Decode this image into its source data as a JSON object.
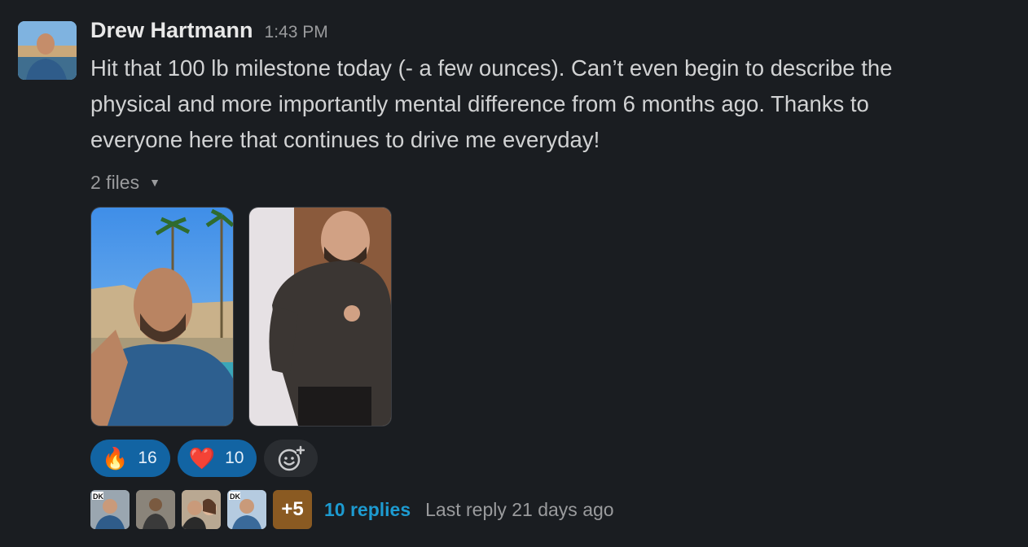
{
  "message": {
    "author": "Drew Hartmann",
    "time": "1:43 PM",
    "lines": [
      "Hit that 100 lb milestone today (- a few ounces).  Can’t even begin to describe the",
      "physical and more importantly mental difference from 6 months ago.  Thanks to",
      "everyone here that continues to drive me everyday!"
    ]
  },
  "files": {
    "label": "2 files",
    "caret_icon": "caret-down-icon"
  },
  "reactions": [
    {
      "emoji": "🔥",
      "count": "16",
      "icon": "fire-emoji"
    },
    {
      "emoji": "❤️",
      "count": "10",
      "icon": "heart-emoji"
    }
  ],
  "thread": {
    "more_count": "+5",
    "replies": "10 replies",
    "last_reply": "Last reply 21 days ago"
  },
  "colors": {
    "background": "#1a1d21",
    "reaction_bg": "#1264a3",
    "link": "#1d9bd1"
  }
}
